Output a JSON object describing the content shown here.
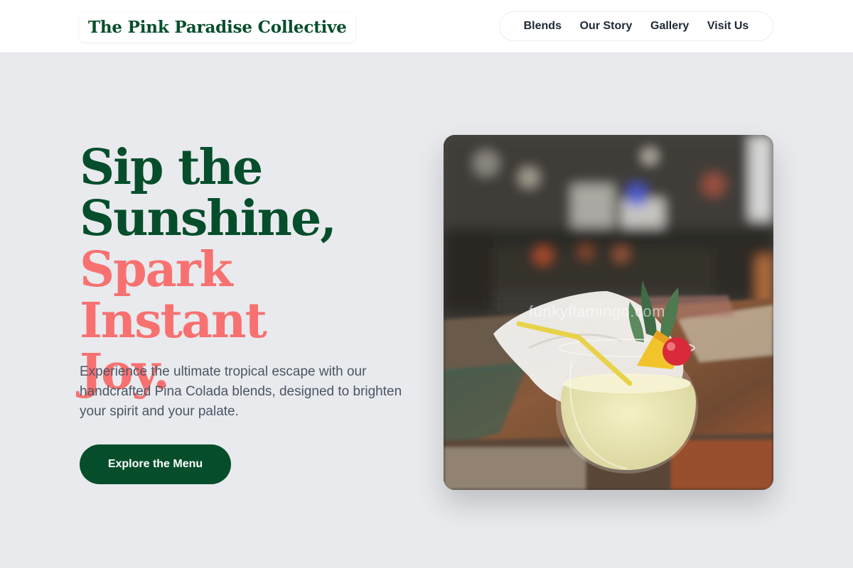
{
  "brand": {
    "name": "The Pink Paradise Collective"
  },
  "nav": {
    "items": [
      "Blends",
      "Our Story",
      "Gallery",
      "Visit Us"
    ]
  },
  "hero": {
    "headline_line1": "Sip the",
    "headline_line2": "Sunshine,",
    "headline_line3": "Spark Instant",
    "headline_line4": "Joy.",
    "lead": "Experience the ultimate tropical escape with our handcrafted Pina Colada blends, designed to brighten your spirit and your palate.",
    "cta_label": "Explore the Menu",
    "image_watermark": "funkyflamingo.com"
  },
  "colors": {
    "brand_green": "#064e2b",
    "accent_coral": "#f87171",
    "background": "#e8eaee"
  }
}
